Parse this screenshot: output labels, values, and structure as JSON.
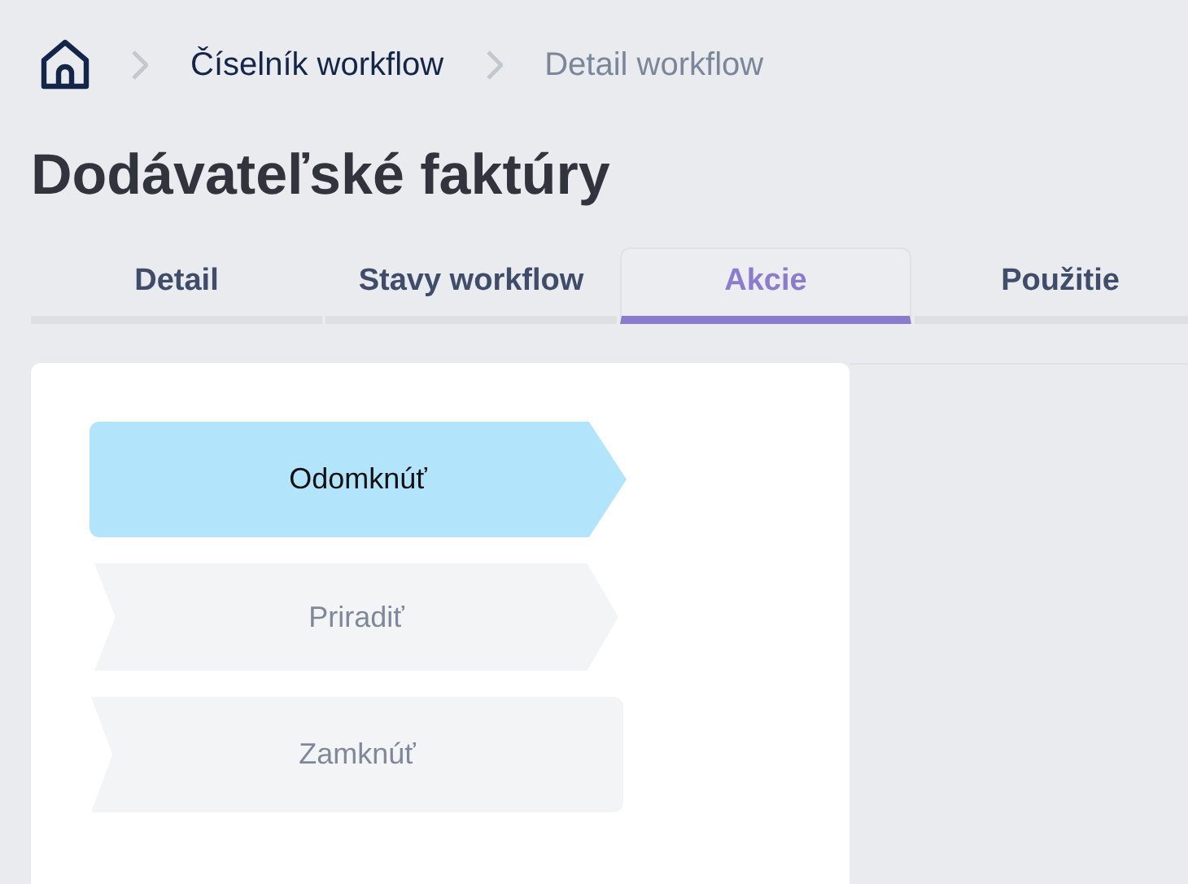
{
  "breadcrumb": [
    {
      "label": "Číselník workflow",
      "kind": "link"
    },
    {
      "label": "Detail workflow",
      "kind": "current"
    }
  ],
  "title": "Dodávateľské faktúry",
  "tabs": [
    {
      "label": "Detail",
      "selected": false
    },
    {
      "label": "Stavy workflow",
      "selected": false
    },
    {
      "label": "Akcie",
      "selected": true
    },
    {
      "label": "Použitie",
      "selected": false
    }
  ],
  "actions": [
    {
      "label": "Odomknúť",
      "kind": "start",
      "selected": true
    },
    {
      "label": "Priradiť",
      "kind": "middle",
      "selected": false
    },
    {
      "label": "Zamknúť",
      "kind": "end",
      "selected": false
    }
  ]
}
